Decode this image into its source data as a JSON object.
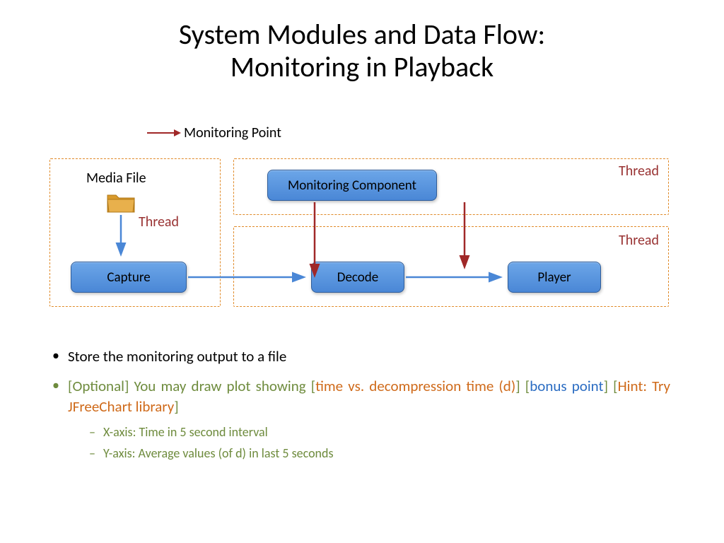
{
  "title": {
    "line1": "System Modules and Data Flow:",
    "line2": "Monitoring in Playback"
  },
  "legend": {
    "label": "Monitoring Point"
  },
  "diagram": {
    "media_file_label": "Media File",
    "thread_label": "Thread",
    "boxes": {
      "monitoring": "Monitoring Component",
      "capture": "Capture",
      "decode": "Decode",
      "player": "Player"
    }
  },
  "bullets": {
    "item1": "Store the monitoring output to a file",
    "item2": {
      "prefix": "[Optional] You may draw plot showing [",
      "orange1": "time vs. decompression time (d)",
      "mid1": "] [",
      "blue": "bonus point",
      "mid2": "] [",
      "orange2": "Hint: Try JFreeChart library",
      "suffix": "]"
    },
    "sub1": "X-axis: Time in 5 second interval",
    "sub2": "Y-axis: Average values (of d)  in last 5 seconds"
  }
}
